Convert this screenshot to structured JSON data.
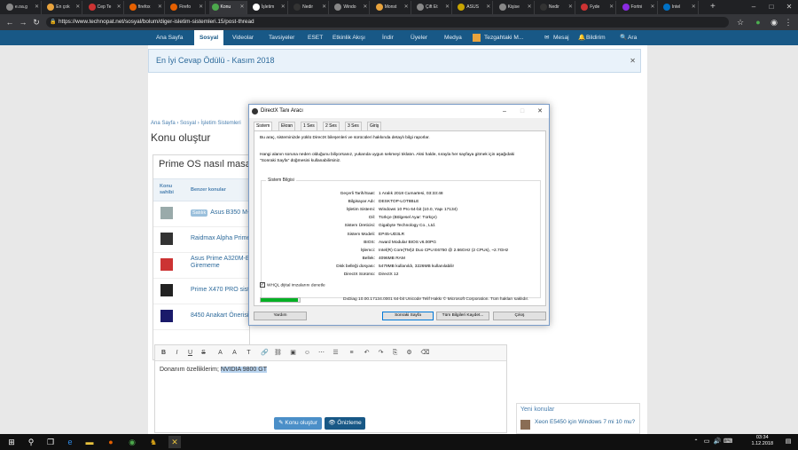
{
  "browser": {
    "tabs": [
      "e.oa.g",
      "En çok",
      "Cep Te",
      "firefox",
      "Firefo",
      "Konu",
      "İşletim",
      "Nedir",
      "Windo",
      "Monst",
      "Çift Et",
      "ASUS",
      "Kişise",
      "Nedir",
      "Fyde",
      "Fortni",
      "Intel"
    ],
    "active_tab_index": 5,
    "tab_colors": [
      "#888",
      "#e8a33d",
      "#c33",
      "#e66000",
      "#e66000",
      "#4ca84c",
      "#fff",
      "#333",
      "#888",
      "#e8a33d",
      "#888",
      "#c8a400",
      "#888",
      "#333",
      "#c33",
      "#8a2be2",
      "#0071c5"
    ],
    "new_tab": "+",
    "url": "https://www.technopat.net/sosyal/bolum/diger-isletim-sistemleri.15/post-thread",
    "window_controls": [
      "–",
      "□",
      "✕"
    ]
  },
  "site": {
    "nav": [
      "Ana Sayfa",
      "Sosyal",
      "Videolar",
      "Tavsiyeler",
      "ESET",
      "Etkinlik Akışı",
      "İndir",
      "Üyeler",
      "Medya"
    ],
    "nav_active": "Sosyal",
    "user": "Tezgahtaki M...",
    "mesaj": "Mesaj",
    "bildirim": "Bildirim",
    "ara": "Ara",
    "award": "En İyi Cevap Ödülü - Kasım 2018",
    "breadcrumb": "Ana Sayfa  ›  Sosyal  ›  İşletim Sistemleri",
    "page_title": "Konu oluştur",
    "thread_title": "Prime OS nasıl masa",
    "col_author": "Konu\nsahibi",
    "col_similar": "Benzer konular",
    "similar": [
      {
        "badge": "Satılık",
        "title": "Asus B350 M-"
      },
      {
        "badge": "",
        "title": "Raidmax Alpha Prime"
      },
      {
        "badge": "",
        "title": "Asus Prime A320M-E\nGirememe"
      },
      {
        "badge": "",
        "title": "Prime X470 PRO sist"
      },
      {
        "badge": "",
        "title": "8450 Anakart Önerisi"
      }
    ],
    "editor_text_prefix": "Donanım özelliklerim; ",
    "editor_text_selected": "NVIDIA 9800 GT",
    "btn_create": "Konu oluştur",
    "btn_preview": "Önizleme",
    "sidebar_title": "Yeni konular",
    "sidebar_item": "Xeon E5450 için Windows 7 mi 10 mu?"
  },
  "dialog": {
    "title": "DirectX Tanı Aracı",
    "tabs": [
      "Sistem",
      "Ekran",
      "1 Ses",
      "2 Ses",
      "3 Ses",
      "Giriş"
    ],
    "intro1": "Bu araç, sisteminizde yüklü DirectX bileşenleri ve sürücüleri hakkında detaylı bilgi raporlar.",
    "intro2": "Hangi alanın soruna neden olduğunu biliyorsanız, yukarıda uygun sekmeyi tıklatın. Aksi halde, sırayla her sayfaya gitmek için aşağıdaki",
    "intro3": "\"Sonraki Sayfa\" düğmesini kullanabilirsiniz.",
    "group_title": "Sistem Bilgisi",
    "info": [
      {
        "k": "Geçerli Tarih/Saat:",
        "v": "1 Aralık 2018 Cumartesi, 03:33:48"
      },
      {
        "k": "Bilgisayar Adı:",
        "v": "DESKTOP-LOT8BLE"
      },
      {
        "k": "İşletim Sistemi:",
        "v": "Windows 10 Pro 64-bit (10.0, Yapı 17134)"
      },
      {
        "k": "Dil:",
        "v": "Türkçe (Bölgesel Ayar: Türkçe)"
      },
      {
        "k": "Sistem Üreticisi:",
        "v": "Gigabyte Technology Co., Ltd."
      },
      {
        "k": "Sistem Modeli:",
        "v": "EP45-UD3LR"
      },
      {
        "k": "BIOS:",
        "v": "Award Modular BIOS v6.00PG"
      },
      {
        "k": "İşlemci:",
        "v": "Intel(R) Core(TM)2 Duo CPU     E6750  @ 2.66GHz (2 CPUs), ~2.7GHz"
      },
      {
        "k": "Bellek:",
        "v": "4096MB RAM"
      },
      {
        "k": "Disk belleği dosyası:",
        "v": "5479MB kullanıldı, 3226MB kullanılabilir"
      },
      {
        "k": "DirectX Sürümü:",
        "v": "DirectX 12"
      }
    ],
    "whql": "WHQL dijital imzalarını denetle",
    "progress": 0.95,
    "dxdiag": "DxDiag 10.00.17134.0001 64-bit Unicode  Telif Hakkı © Microsoft Corporation. Tüm hakları saklıdır.",
    "btn_help": "Yardım",
    "btn_next": "Sonraki Sayfa",
    "btn_save": "Tüm Bilgileri Kaydet...",
    "btn_exit": "Çıkış"
  },
  "taskbar": {
    "time": "03:34",
    "date": "1.12.2018"
  }
}
